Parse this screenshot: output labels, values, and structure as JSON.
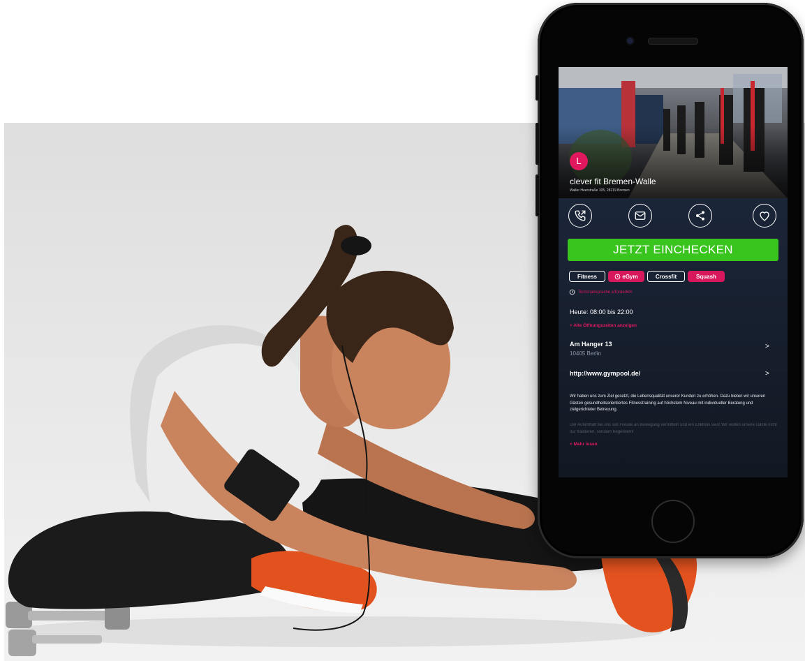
{
  "gym": {
    "avatar_letter": "L",
    "name": "clever fit Bremen-Walle",
    "address": "Waller Heerstraße 105, 28219 Bremen"
  },
  "actions": {
    "call_icon": "phone-call-icon",
    "mail_icon": "mail-icon",
    "share_icon": "share-icon",
    "favorite_icon": "heart-icon"
  },
  "checkin_label": "JETZT EINCHECKEN",
  "tags": [
    {
      "label": "Fitness",
      "style": "outline"
    },
    {
      "label": "eGym",
      "style": "filled",
      "icon": "clock-icon"
    },
    {
      "label": "Crossfit",
      "style": "outline"
    },
    {
      "label": "Squash",
      "style": "filled"
    }
  ],
  "notice": "Terminabsprache erforderlich",
  "hours": {
    "today": "Heute: 08:00 bis 22:00",
    "all_link": "+ Alle Öffnungszeiten anzeigen"
  },
  "location": {
    "street": "Am Hanger 13",
    "city": "10405 Berlin",
    "chevron": ">"
  },
  "website": {
    "url": "http://www.gympool.de/",
    "chevron": ">"
  },
  "description": "Wir haben uns zum Ziel gesetzt, die Lebensqualität unserer Kunden zu erhöhen. Dazu bieten wir unseren Gästen gesundheitsorientiertes Fitnesstraining auf höchstem Niveau mit individueller Beratung und zielgerichteter Betreuung.",
  "description_more": "Der Aufenthalt bei uns soll Freude an Bewegung vermitteln und ein Erlebnis sein! Wir wollen unsere Gäste nicht nur trainieren, sondern begeistern!",
  "read_more": "+ Mehr lesen",
  "colors": {
    "accent_pink": "#e0195f",
    "checkin_green": "#39c41e",
    "screen_bg": "#1a2436"
  }
}
